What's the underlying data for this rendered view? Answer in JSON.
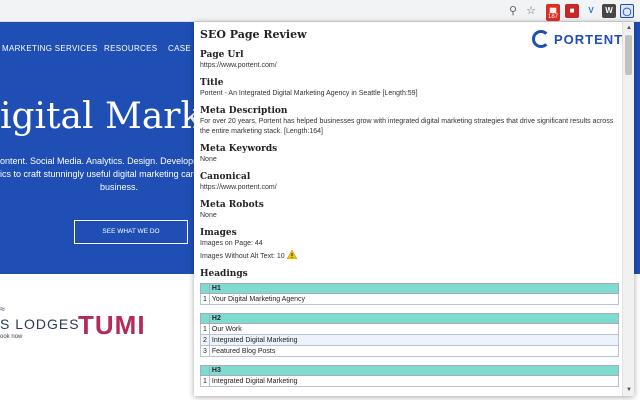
{
  "site": {
    "nav": [
      "MARKETING SERVICES",
      "RESOURCES",
      "CASE S"
    ],
    "hero_title": "igital Marketi",
    "hero_sub_1": "ontent. Social Media. Analytics. Design. Developmen",
    "hero_sub_2": "ics to craft stunningly useful digital marketing camp",
    "hero_sub_3": "business.",
    "hero_button": "SEE WHAT WE DO",
    "logo_lodges": "S LODGES",
    "logo_lodges_sub": "ook now",
    "logo_tumi": "TUMI"
  },
  "toolbar": {
    "ext_badge": "187"
  },
  "popup": {
    "title": "SEO Page Review",
    "brand": "PORTENT",
    "sections": {
      "page_url": {
        "label": "Page Url",
        "value": "https://www.portent.com/"
      },
      "title": {
        "label": "Title",
        "value": "Portent - An Integrated Digital Marketing Agency in Seattle [Length:59]"
      },
      "meta_description": {
        "label": "Meta Description",
        "value": "For over 20 years, Portent has helped businesses grow with integrated digital marketing strategies that drive significant results across the entire marketing stack. [Length:164]"
      },
      "meta_keywords": {
        "label": "Meta Keywords",
        "value": "None"
      },
      "canonical": {
        "label": "Canonical",
        "value": "https://www.portent.com/"
      },
      "meta_robots": {
        "label": "Meta Robots",
        "value": "None"
      },
      "images": {
        "label": "Images",
        "on_page": "Images on Page: 44",
        "without_alt": "Images Without Alt Text: 10"
      }
    },
    "headings": {
      "label": "Headings",
      "h1": {
        "label": "H1",
        "rows": [
          {
            "n": "1",
            "text": "Your Digital Marketing Agency"
          }
        ]
      },
      "h2": {
        "label": "H2",
        "rows": [
          {
            "n": "1",
            "text": "Our Work"
          },
          {
            "n": "2",
            "text": "Integrated Digital Marketing"
          },
          {
            "n": "3",
            "text": "Featured Blog Posts"
          }
        ]
      },
      "h3": {
        "label": "H3",
        "rows": [
          {
            "n": "1",
            "text": "Integrated Digital Marketing"
          }
        ]
      }
    }
  },
  "colors": {
    "hero_blue": "#1f4fb5",
    "heading_teal": "#7ddccf",
    "brand_blue": "#1f4fb5"
  }
}
